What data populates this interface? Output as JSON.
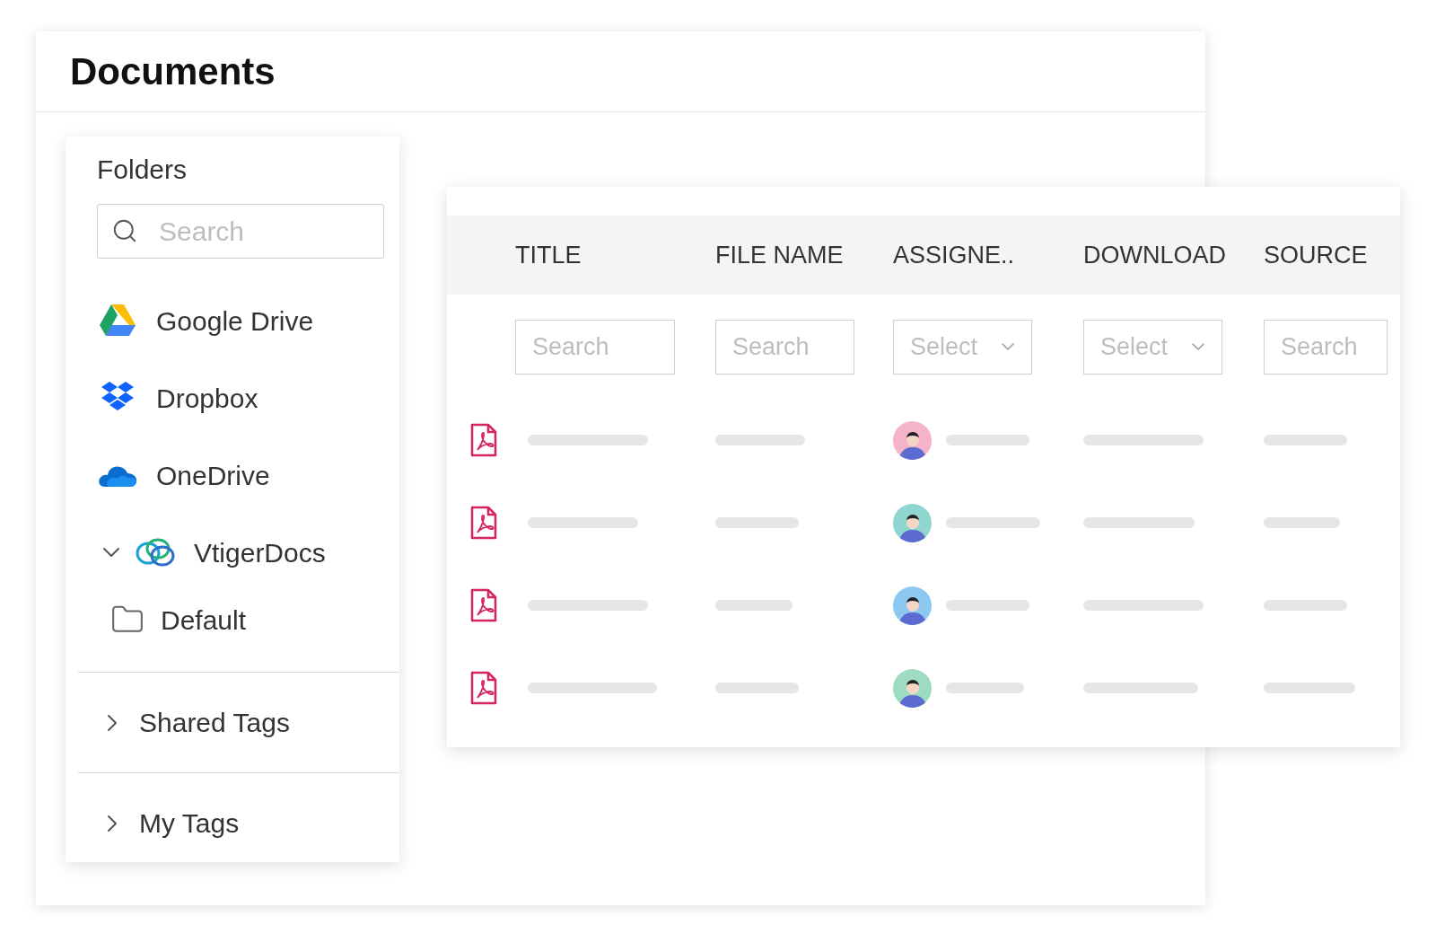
{
  "page": {
    "title": "Documents"
  },
  "folders": {
    "title": "Folders",
    "search": {
      "placeholder": "Search"
    },
    "items": [
      {
        "kind": "gdrive",
        "label": "Google Drive"
      },
      {
        "kind": "dropbox",
        "label": "Dropbox"
      },
      {
        "kind": "onedrive",
        "label": "OneDrive"
      },
      {
        "kind": "vtiger",
        "label": "VtigerDocs",
        "expanded": true,
        "children": [
          {
            "label": "Default"
          }
        ]
      }
    ],
    "tag_sections": [
      {
        "label": "Shared Tags",
        "expanded": false
      },
      {
        "label": "My Tags",
        "expanded": false
      }
    ]
  },
  "table": {
    "columns": [
      {
        "label": "TITLE",
        "filter": {
          "kind": "search",
          "placeholder": "Search"
        }
      },
      {
        "label": "FILE NAME",
        "filter": {
          "kind": "search",
          "placeholder": "Search"
        }
      },
      {
        "label": "ASSIGNE..",
        "filter": {
          "kind": "select",
          "placeholder": "Select"
        }
      },
      {
        "label": "DOWNLOAD",
        "filter": {
          "kind": "select",
          "placeholder": "Select"
        }
      },
      {
        "label": "SOURCE",
        "filter": {
          "kind": "search",
          "placeholder": "Search"
        }
      }
    ],
    "rows": [
      {
        "color": "#f4b3c8"
      },
      {
        "color": "#8fd6d0"
      },
      {
        "color": "#8cc8ef"
      },
      {
        "color": "#9ddcc0"
      }
    ]
  }
}
